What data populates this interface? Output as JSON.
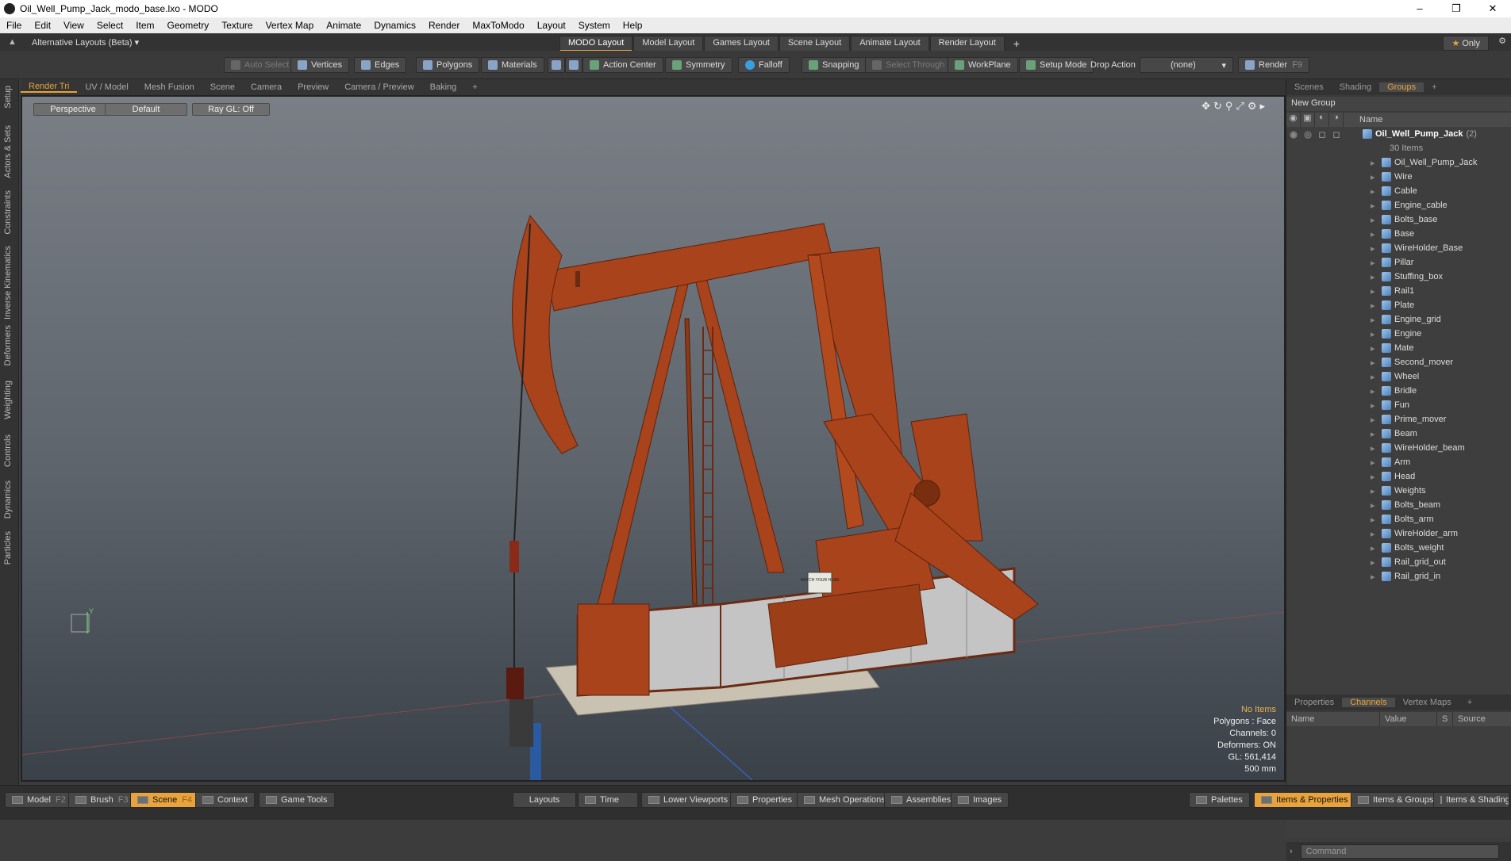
{
  "window": {
    "title": "Oil_Well_Pump_Jack_modo_base.lxo - MODO"
  },
  "menu": [
    "File",
    "Edit",
    "View",
    "Select",
    "Item",
    "Geometry",
    "Texture",
    "Vertex Map",
    "Animate",
    "Dynamics",
    "Render",
    "MaxToModo",
    "Layout",
    "System",
    "Help"
  ],
  "layout_bar": {
    "alt_layouts": "Alternative Layouts (Beta) ▾",
    "tabs": [
      "MODO Layout",
      "Model Layout",
      "Games Layout",
      "Scene Layout",
      "Animate Layout",
      "Render Layout"
    ],
    "active_tab": "MODO Layout",
    "only_label": "Only"
  },
  "toolbar": {
    "auto_select": "Auto Select",
    "vertices": "Vertices",
    "edges": "Edges",
    "polygons": "Polygons",
    "materials": "Materials",
    "action_center": "Action Center",
    "symmetry": "Symmetry",
    "falloff": "Falloff",
    "snapping": "Snapping",
    "select_through": "Select Through",
    "workplane": "WorkPlane",
    "setup_mode": "Setup Mode",
    "drop_action_label": "Drop Action",
    "drop_action_value": "(none)",
    "render": "Render",
    "render_key": "F9"
  },
  "left_tabs": [
    "Setup",
    "Actors & Sets",
    "Constraints",
    "Inverse Kinematics",
    "Deformers",
    "Weighting",
    "Controls",
    "Dynamics",
    "Particles"
  ],
  "viewport_tabs": [
    "Render Tri",
    "UV / Model",
    "Mesh Fusion",
    "Scene",
    "Camera",
    "Preview",
    "Camera / Preview",
    "Baking",
    "+"
  ],
  "viewport": {
    "view_mode": "Perspective",
    "shading": "Default",
    "raygl": "Ray GL: Off",
    "info": {
      "selection": "No Items",
      "polygons": "Polygons : Face",
      "channels": "Channels: 0",
      "deformers": "Deformers: ON",
      "gl": "GL: 561,414",
      "scale": "500 mm"
    },
    "sign_text": "WATCH YOUR HEAD"
  },
  "right_panel": {
    "top_tabs": [
      "Scenes",
      "Shading",
      "Groups",
      "+"
    ],
    "active_top_tab": "Groups",
    "new_group": "New Group",
    "name_col": "Name",
    "root": {
      "name": "Oil_Well_Pump_Jack",
      "count": "(2)",
      "sub": "30 Items"
    },
    "items": [
      "Oil_Well_Pump_Jack",
      "Wire",
      "Cable",
      "Engine_cable",
      "Bolts_base",
      "Base",
      "WireHolder_Base",
      "Pillar",
      "Stuffing_box",
      "Rail1",
      "Plate",
      "Engine_grid",
      "Engine",
      "Mate",
      "Second_mover",
      "Wheel",
      "Bridle",
      "Fun",
      "Prime_mover",
      "Beam",
      "WireHolder_beam",
      "Arm",
      "Head",
      "Weights",
      "Bolts_beam",
      "Bolts_arm",
      "WireHolder_arm",
      "Bolts_weight",
      "Rail_grid_out",
      "Rail_grid_in"
    ],
    "bottom_tabs": [
      "Properties",
      "Channels",
      "Vertex Maps",
      "+"
    ],
    "active_bottom_tab": "Channels",
    "channel_cols": [
      "Name",
      "Value",
      "S",
      "Source"
    ],
    "command_placeholder": "Command"
  },
  "bottom_bar": {
    "model": "Model",
    "model_key": "F2",
    "brush": "Brush",
    "brush_key": "F3",
    "scene": "Scene",
    "scene_key": "F4",
    "context": "Context",
    "game_tools": "Game Tools",
    "layouts": "Layouts",
    "time": "Time",
    "lower_viewports": "Lower Viewports",
    "properties": "Properties",
    "mesh_operations": "Mesh Operations",
    "assemblies": "Assemblies",
    "images": "Images",
    "palettes": "Palettes",
    "items_properties": "Items & Properties",
    "items_groups": "Items & Groups",
    "items_shading": "Items & Shading"
  }
}
